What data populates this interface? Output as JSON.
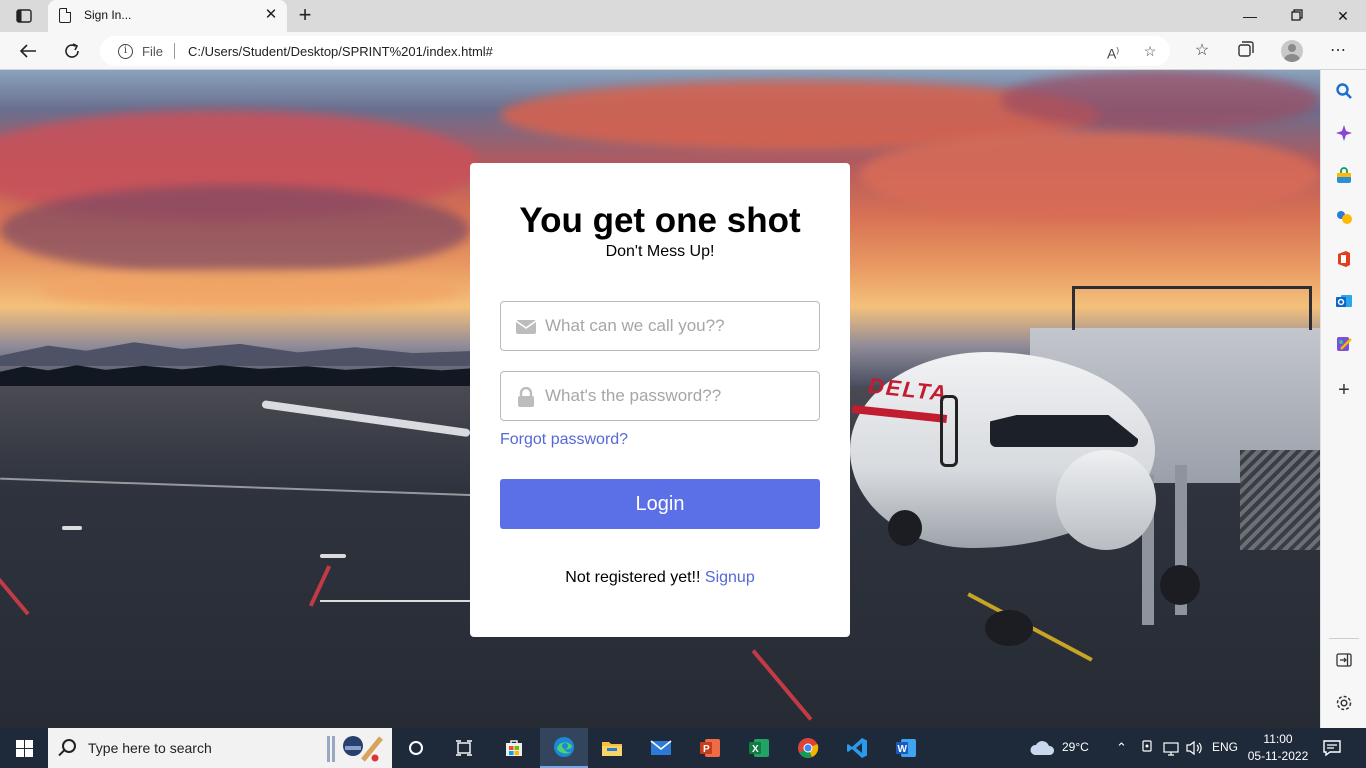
{
  "browser": {
    "tab_title": "Sign In...",
    "url_scheme_label": "File",
    "url": "C:/Users/Student/Desktop/SPRINT%201/index.html#"
  },
  "login": {
    "title": "You get one shot",
    "subtitle": "Don't Mess Up!",
    "username_placeholder": "What can we call you??",
    "password_placeholder": "What's the password??",
    "forgot_label": "Forgot password?",
    "login_label": "Login",
    "register_prompt": "Not registered yet!!",
    "signup_label": "Signup",
    "accent_color": "#5b6fe7",
    "link_color": "#5568d8"
  },
  "background": {
    "airline_livery": "DELTA"
  },
  "sidebar": {
    "icons": [
      "search-icon",
      "copilot-icon",
      "shopping-icon",
      "games-icon",
      "office-icon",
      "outlook-icon",
      "designer-icon",
      "add-icon",
      "hide-sidebar-icon",
      "settings-icon"
    ]
  },
  "taskbar": {
    "search_placeholder": "Type here to search",
    "temperature": "29°C",
    "language": "ENG",
    "time": "11:00",
    "date": "05-11-2022",
    "apps": [
      "cortana-icon",
      "task-view-icon",
      "store-icon",
      "edge-icon",
      "file-explorer-icon",
      "mail-icon",
      "powerpoint-icon",
      "excel-icon",
      "chrome-icon",
      "vscode-icon",
      "word-icon"
    ]
  }
}
